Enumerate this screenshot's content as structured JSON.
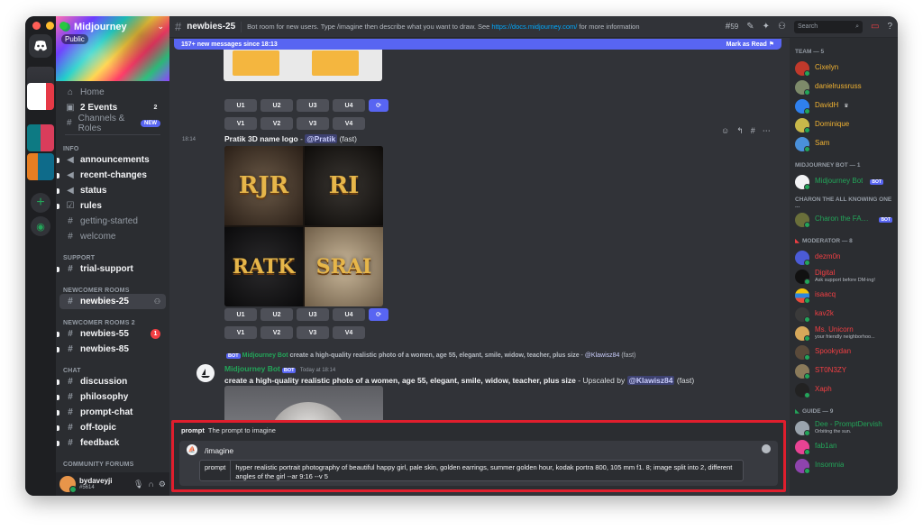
{
  "server": {
    "name": "Midjourney",
    "public_label": "Public"
  },
  "sidebar": {
    "home": "Home",
    "events": "2 Events",
    "events_count": "2",
    "channels_roles": "Channels & Roles",
    "new_badge": "NEW",
    "categories": {
      "info": "INFO",
      "support": "SUPPORT",
      "newcomer_rooms": "NEWCOMER ROOMS",
      "newcomer_rooms_2": "NEWCOMER ROOMS 2",
      "chat": "CHAT",
      "community_forums": "COMMUNITY FORUMS"
    },
    "info_channels": [
      "announcements",
      "recent-changes",
      "status",
      "rules",
      "getting-started",
      "welcome"
    ],
    "support_channels": [
      "trial-support"
    ],
    "newcomer_channels": [
      "newbies-25"
    ],
    "newcomer2_channels": [
      "newbies-55",
      "newbies-85"
    ],
    "newbies55_badge": "1",
    "chat_channels": [
      "discussion",
      "philosophy",
      "prompt-chat",
      "off-topic",
      "feedback"
    ]
  },
  "user": {
    "name": "bydaveyji",
    "tag": "#5614"
  },
  "header": {
    "channel": "newbies-25",
    "topic_prefix": "Bot room for new users. Type /imagine then describe what you want to draw. See ",
    "topic_link": "https://docs.midjourney.com/",
    "topic_suffix": " for more information",
    "thread_count": "59",
    "search_placeholder": "Search"
  },
  "new_messages": {
    "text": "157+ new messages since 18:13",
    "action": "Mark as Read"
  },
  "messages": {
    "upscale_buttons": [
      "U1",
      "U2",
      "U3",
      "U4"
    ],
    "variation_buttons": [
      "V1",
      "V2",
      "V3",
      "V4"
    ],
    "job1": {
      "time": "18:14",
      "prompt": "Pratik 3D name logo",
      "separator": " - ",
      "mention": "@Pratik",
      "speed": "(fast)"
    },
    "job2": {
      "reply_bot": "Midjourney Bot",
      "bot_tag": "BOT",
      "reply_text": "create a high-quality realistic photo of a women, age 55, elegant, smile, widow, teacher, plus size",
      "reply_sep": " - ",
      "reply_mention": "@Klawisz84",
      "reply_speed": "(fast)",
      "author": "Midjourney Bot",
      "timestamp": "Today at 18:14",
      "prompt": "create a high-quality realistic photo of a women, age 55, elegant, smile, widow, teacher, plus size",
      "upscaled_by": " - Upscaled by ",
      "mention": "@Klawisz84",
      "speed": "(fast)"
    },
    "logo_tiles": [
      "RJR",
      "RI",
      "RATK",
      "SRAI"
    ]
  },
  "prompt": {
    "hint_label": "prompt",
    "hint_text": "The prompt to imagine",
    "command": "/imagine",
    "option_label": "prompt",
    "option_value": "hyper realistic portrait photography of beautiful happy girl, pale skin, golden earrings, summer golden hour, kodak portra 800, 105 mm f1. 8; image split into 2, different angles of the girl --ar 9:16 --v 5"
  },
  "members": {
    "team_header": "TEAM — 5",
    "team": [
      "Cixelyn",
      "danielrussruss",
      "DavidH",
      "Dominique",
      "Sam"
    ],
    "bot_header": "MIDJOURNEY BOT — 1",
    "bot": "Midjourney Bot",
    "charon_header": "CHARON THE ALL KNOWING ONE ...",
    "charon": "Charon the FAQ ...",
    "mod_header": "MODERATOR — 8",
    "mods": [
      "dezm0n",
      "Digital",
      "isaacq",
      "kav2k",
      "Ms. Unicorn",
      "Spookydan",
      "ST0N3ZY",
      "Xaph"
    ],
    "digital_sub": "Ask support before DM-ing!",
    "unicorn_sub": "your friendly neighborhoo...",
    "guide_header": "GUIDE — 9",
    "guides": [
      "Dee - PromptDervish",
      "fab1an",
      "Insomnia"
    ],
    "dee_sub": "Orbiting the sun.",
    "bot_badge": "BOT"
  },
  "colors": {
    "accent": "#5865f2",
    "online": "#23a559",
    "highlight_border": "#e01e2d",
    "team_color": "#f0b232",
    "mod_color": "#f23f43",
    "guide_color": "#23a559"
  }
}
